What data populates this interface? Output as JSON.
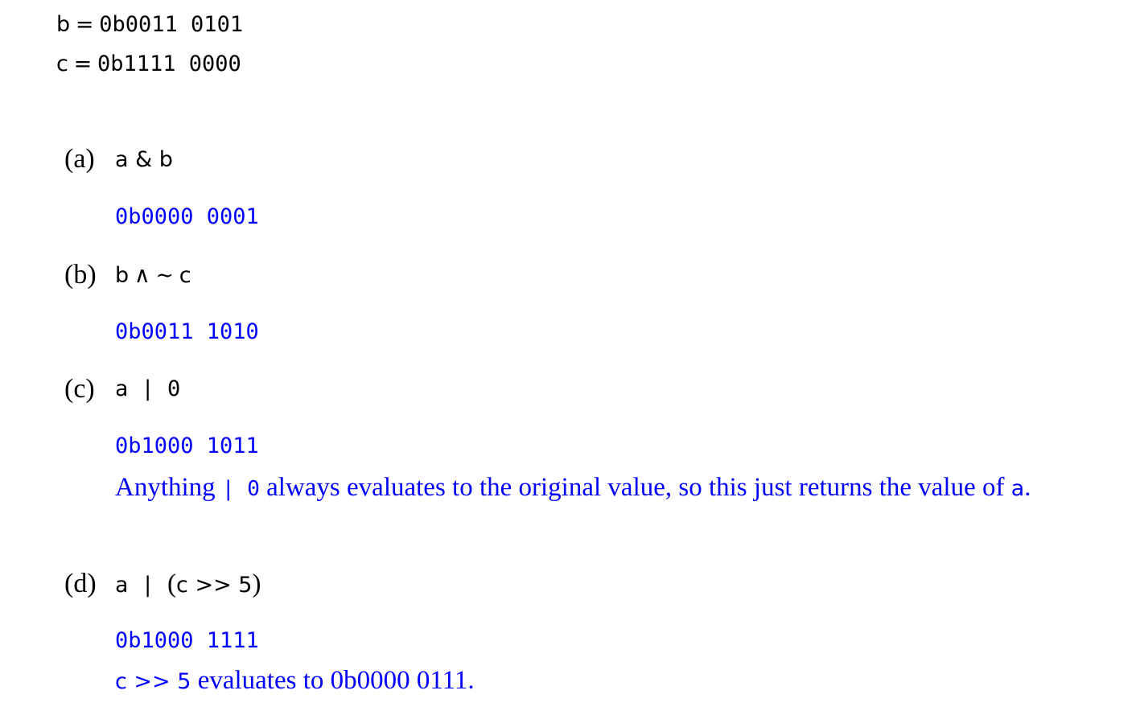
{
  "variables": [
    {
      "name": "b",
      "eq": "=",
      "value": "0b0011 0101"
    },
    {
      "name": "c",
      "eq": "=",
      "value": "0b1111 0000"
    }
  ],
  "parts": {
    "a": {
      "label": "(a)",
      "expr": "a & b",
      "answer": "0b0000 0001"
    },
    "b": {
      "label": "(b)",
      "expr_b": "b",
      "expr_and": "∧",
      "expr_not": "∼",
      "expr_c": "c",
      "answer": "0b0011 1010"
    },
    "c": {
      "label": "(c)",
      "expr": "a | 0",
      "answer": "0b1000 1011",
      "explain_1": "Anything ",
      "explain_code": "| 0",
      "explain_2": " always evaluates to the original value, so this just returns the value of ",
      "explain_var": "a",
      "explain_3": "."
    },
    "d": {
      "label": "(d)",
      "expr_pre": "a | ",
      "expr_open": "(",
      "expr_mid": "c >> 5",
      "expr_close": ")",
      "answer": "0b1000 1111",
      "note_code": "c >> 5",
      "note_text": " evaluates to 0b0000 0111."
    }
  }
}
